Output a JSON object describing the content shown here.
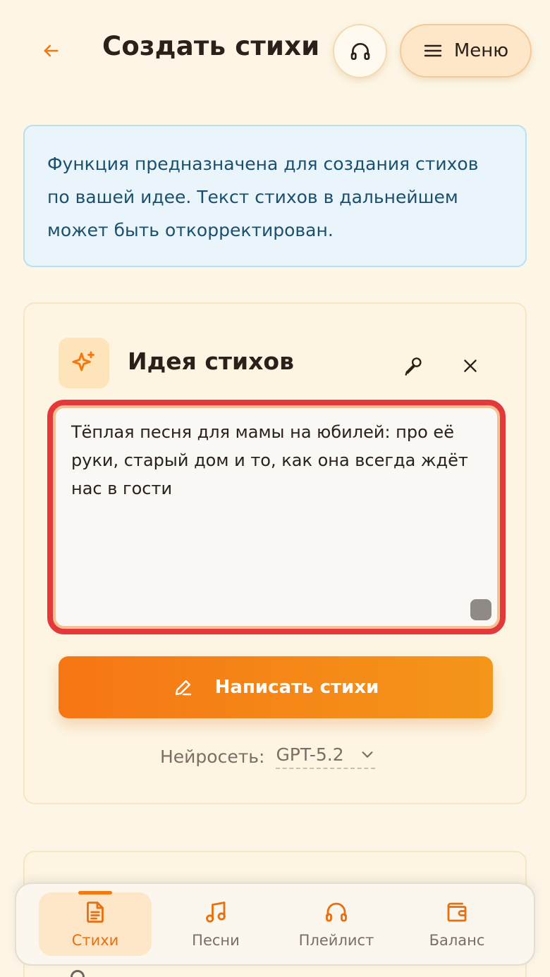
{
  "header": {
    "title": "Создать стихи",
    "menu_label": "Меню"
  },
  "info": {
    "text": "Функция предназначена для создания стихов по вашей идее. Текст стихов в дальнейшем может быть откорректирован."
  },
  "idea_card": {
    "title": "Идея стихов",
    "textarea_value": "Тёплая песня для мамы на юбилей: про её руки, старый дом и то, как она всегда ждёт нас в гости",
    "submit_label": "Написать стихи",
    "model_label": "Нейросеть:",
    "model_value": "GPT-5.2"
  },
  "bottom_nav": {
    "items": [
      {
        "label": "Стихи",
        "icon": "document-icon",
        "active": true
      },
      {
        "label": "Песни",
        "icon": "music-note-icon",
        "active": false
      },
      {
        "label": "Плейлист",
        "icon": "headphones-icon",
        "active": false
      },
      {
        "label": "Баланс",
        "icon": "wallet-icon",
        "active": false
      }
    ]
  },
  "colors": {
    "accent": "#f27a12",
    "background": "#fdf6e6",
    "info_bg": "#eaf5fb",
    "info_text": "#1b4f6e",
    "focus_ring": "#e3393a"
  }
}
